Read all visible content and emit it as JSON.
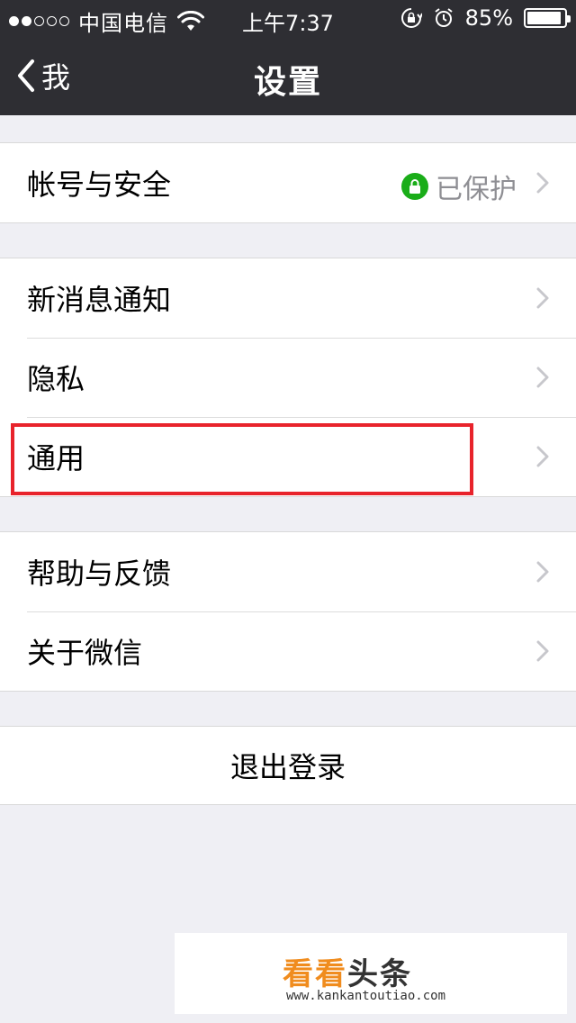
{
  "status_bar": {
    "signal_dots_filled": 2,
    "signal_dots_total": 5,
    "carrier": "中国电信",
    "time": "上午7:37",
    "battery_percent_text": "85%",
    "battery_level": 0.85,
    "icons": [
      "wifi-icon",
      "rotation-lock-icon",
      "alarm-icon",
      "battery-icon"
    ]
  },
  "nav": {
    "back_label": "我",
    "title": "设置"
  },
  "account_group": {
    "item_label": "帐号与安全",
    "status_text": "已保护",
    "status_icon": "lock-icon",
    "status_color": "#1aad19"
  },
  "notify_group": {
    "items": [
      {
        "label": "新消息通知"
      },
      {
        "label": "隐私"
      },
      {
        "label": "通用"
      }
    ]
  },
  "about_group": {
    "items": [
      {
        "label": "帮助与反馈"
      },
      {
        "label": "关于微信"
      }
    ]
  },
  "logout_label": "退出登录",
  "highlight_color": "#e8232b",
  "watermark": {
    "part1": "看看",
    "part2": "头条",
    "url": "www.kankantoutiao.com"
  }
}
